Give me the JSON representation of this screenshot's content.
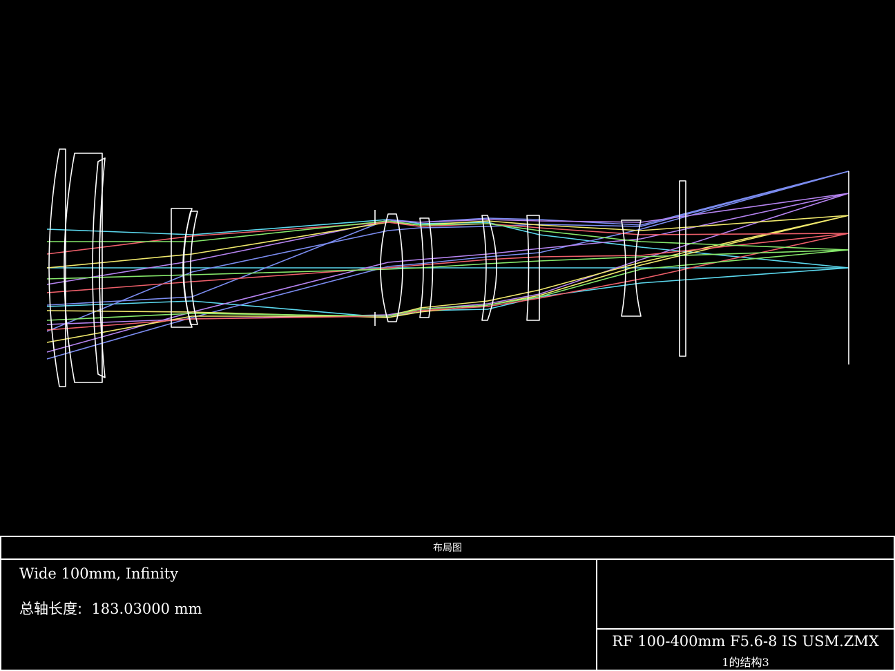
{
  "diagram": {
    "background": "#000000",
    "element_color": "#ffffff",
    "ray_colors": [
      "#5bd8ee",
      "#7b8cf0",
      "#b583f0",
      "#f0e86c",
      "#ee5f6a",
      "#86e86b"
    ]
  },
  "footer": {
    "title": "布局图",
    "line1": "Wide 100mm, Infinity",
    "length_label": "总轴长度:",
    "length_value": "183.03000 mm",
    "file_name": "RF 100-400mm F5.6-8 IS USM.ZMX",
    "configuration": "1的结构3"
  }
}
